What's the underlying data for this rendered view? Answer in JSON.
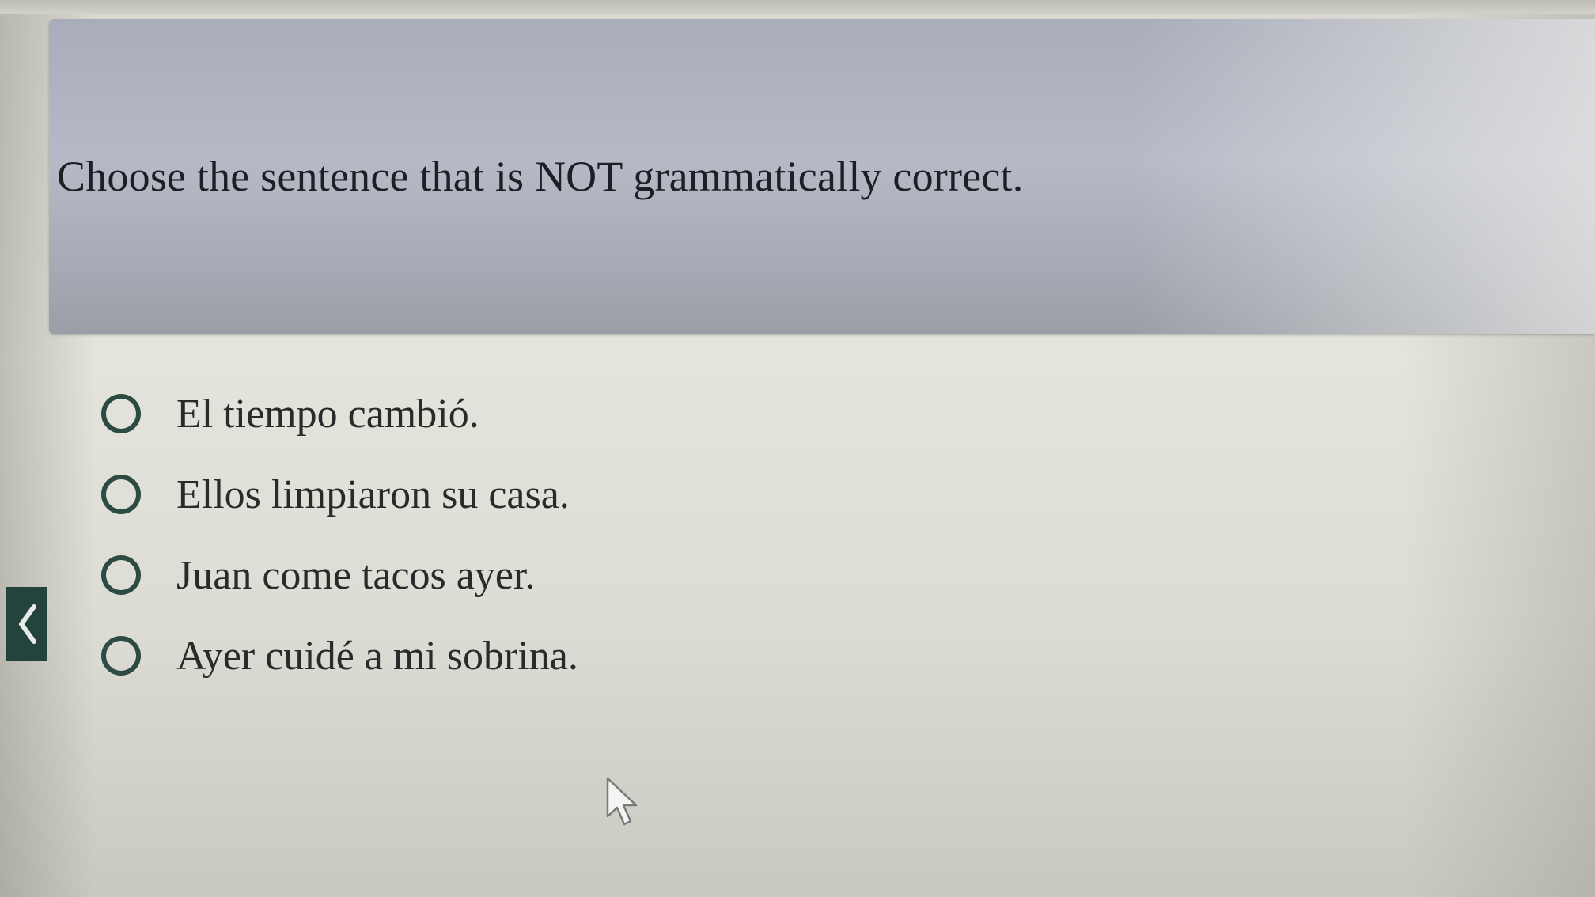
{
  "question": {
    "text": "Choose the sentence that is NOT grammatically correct."
  },
  "options": [
    {
      "label": "El tiempo cambió."
    },
    {
      "label": "Ellos limpiaron su casa."
    },
    {
      "label": "Juan come tacos ayer."
    },
    {
      "label": "Ayer cuidé a mi sobrina."
    }
  ],
  "navigation": {
    "prev_icon": "chevron-left-icon"
  },
  "colors": {
    "card_background": "#b0b4c0",
    "radio_border": "#2c4b42",
    "nav_button": "#24433c",
    "text": "#1d1f24"
  }
}
